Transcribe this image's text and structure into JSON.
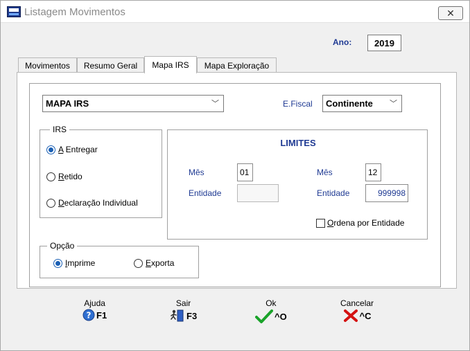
{
  "window": {
    "title": "Listagem Movimentos",
    "close_glyph": "✕"
  },
  "year": {
    "label": "Ano:",
    "value": "2019"
  },
  "tabs": [
    {
      "label": "Movimentos"
    },
    {
      "label": "Resumo Geral"
    },
    {
      "label": "Mapa IRS",
      "active": true
    },
    {
      "label": "Mapa Exploração"
    }
  ],
  "report_select": {
    "value": "MAPA IRS"
  },
  "fiscal": {
    "label": "E.Fiscal",
    "value": "Continente"
  },
  "irs_group": {
    "legend": "IRS",
    "options": [
      {
        "underline": "A",
        "rest": " Entregar",
        "selected": true
      },
      {
        "underline": "R",
        "rest": "etido",
        "selected": false
      },
      {
        "underline": "D",
        "rest": "eclaração Individual",
        "selected": false
      }
    ]
  },
  "limites": {
    "title": "LIMITES",
    "from": {
      "month_label": "Mês",
      "month_value": "01",
      "entity_label": "Entidade",
      "entity_value": ""
    },
    "to": {
      "month_label": "Mês",
      "month_value": "12",
      "entity_label": "Entidade",
      "entity_value": "999998"
    },
    "sort_check": {
      "underline": "O",
      "rest": "rdena por Entidade",
      "checked": false
    }
  },
  "opcao_group": {
    "legend": "Opção",
    "options": [
      {
        "underline": "I",
        "rest": "mprime",
        "selected": true
      },
      {
        "underline": "E",
        "rest": "xporta",
        "selected": false
      }
    ]
  },
  "footer": {
    "help": {
      "caption": "Ajuda",
      "key": "F1"
    },
    "exit": {
      "caption": "Sair",
      "key": "F3"
    },
    "ok": {
      "caption": "Ok",
      "key": "^O"
    },
    "cancel": {
      "caption": "Cancelar",
      "key": "^C"
    }
  },
  "colors": {
    "accent": "#1a5fb4",
    "ok_green": "#1aa32a",
    "cancel_red": "#d41111",
    "label_blue": "#1f3a93"
  }
}
